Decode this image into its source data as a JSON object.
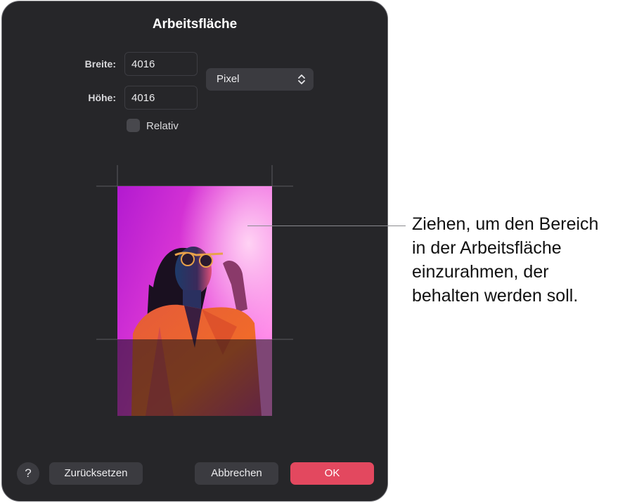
{
  "dialog": {
    "title": "Arbeitsfläche",
    "width_label": "Breite:",
    "width_value": "4016",
    "height_label": "Höhe:",
    "height_value": "4016",
    "unit_selected": "Pixel",
    "relative_label": "Relativ",
    "relative_checked": false
  },
  "buttons": {
    "help": "?",
    "reset": "Zurücksetzen",
    "cancel": "Abbrechen",
    "ok": "OK"
  },
  "callout": {
    "line1": "Ziehen, um den Bereich",
    "line2": "in der Arbeitsfläche",
    "line3": "einzurahmen, der",
    "line4": "behalten werden soll."
  },
  "colors": {
    "dialog_bg": "#262629",
    "ok_accent": "#e3485f"
  }
}
